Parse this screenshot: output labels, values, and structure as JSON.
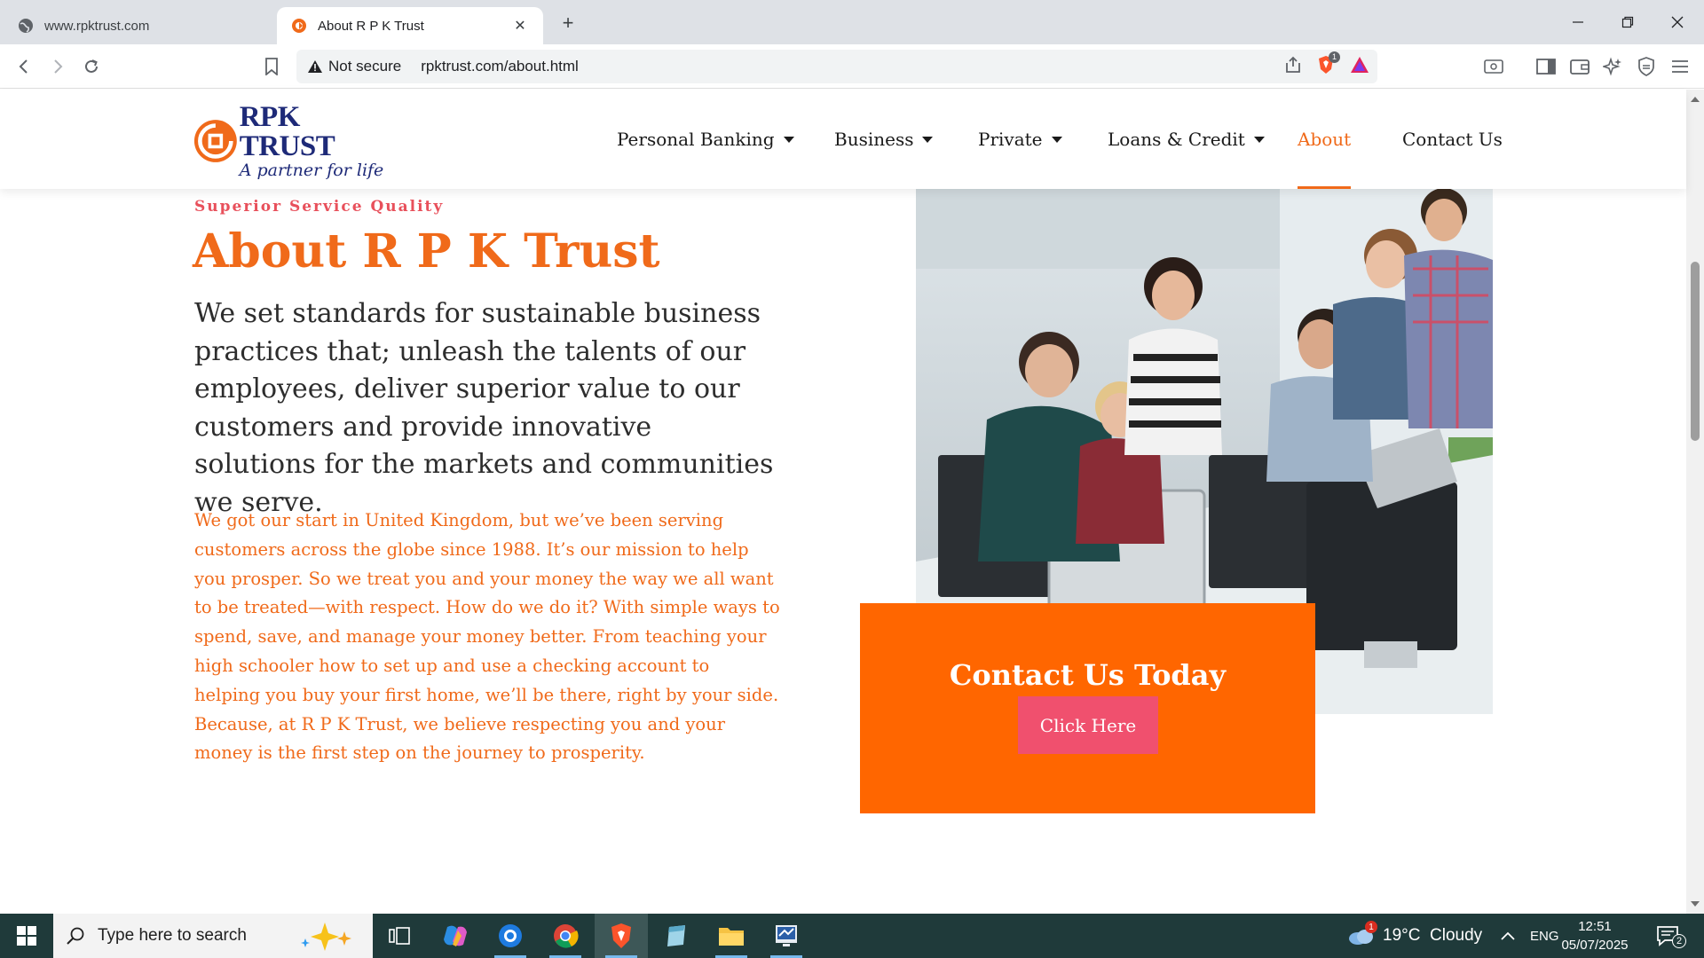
{
  "browser": {
    "tabs": [
      {
        "title": "www.rpktrust.com",
        "active": false
      },
      {
        "title": "About R P K Trust",
        "active": true
      }
    ],
    "security_label": "Not secure",
    "url": "rpktrust.com/about.html",
    "shield_badge": "1"
  },
  "site": {
    "logo": {
      "name": "RPK TRUST",
      "tagline": "A partner for life"
    },
    "nav": [
      {
        "label": "Personal Banking",
        "dropdown": true
      },
      {
        "label": "Business",
        "dropdown": true
      },
      {
        "label": "Private",
        "dropdown": true
      },
      {
        "label": "Loans & Credit",
        "dropdown": true
      },
      {
        "label": "About",
        "dropdown": false,
        "active": true
      },
      {
        "label": "Contact Us",
        "dropdown": false
      }
    ]
  },
  "about": {
    "eyebrow": "Superior Service Quality",
    "title": "About R P K Trust",
    "lead": "We set standards for sustainable business practices that; unleash the talents of our employees, deliver superior value to our customers and provide innovative solutions for the markets and communities we serve.",
    "body": "We got our start in United Kingdom, but we’ve been serving customers across the globe since 1988. It’s our mission to help you prosper. So we treat you and your money the way we all want to be treated—with respect. How do we do it? With simple ways to spend, save, and manage your money better. From teaching your high schooler how to set up and use a checking account to helping you buy your first home, we’ll be there, right by your side. Because, at R P K Trust, we believe respecting you and your money is the first step on the journey to prosperity."
  },
  "cta": {
    "title": "Contact Us Today",
    "button": "Click Here"
  },
  "taskbar": {
    "search_placeholder": "Type here to search",
    "weather": "19°C  Cloudy",
    "weather_badge": "1",
    "language": "ENG",
    "time": "12:51",
    "date": "05/07/2025",
    "notifications": "2"
  },
  "colors": {
    "brand_orange": "#f06a1a",
    "cta_orange": "#ff6600",
    "accent_pink": "#f0506e",
    "logo_navy": "#1e2a78",
    "taskbar": "#1f3a3a"
  }
}
